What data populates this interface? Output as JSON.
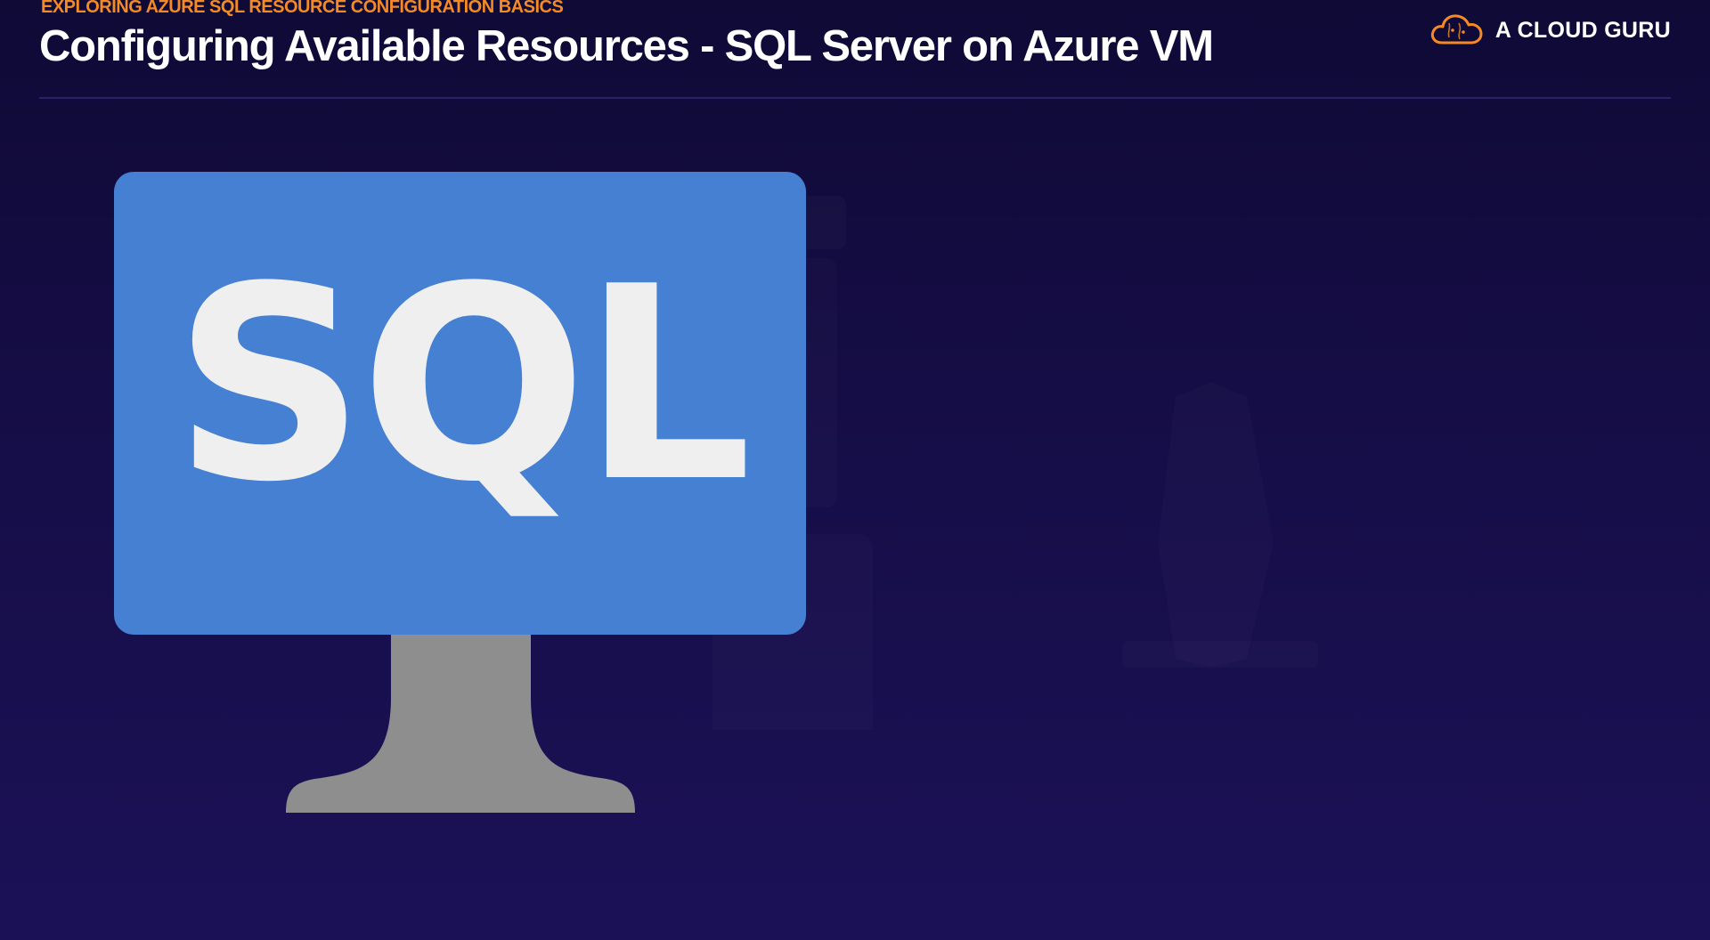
{
  "header": {
    "eyebrow": "EXPLORING AZURE SQL RESOURCE CONFIGURATION BASICS",
    "title": "Configuring Available Resources - SQL Server on Azure VM"
  },
  "logo": {
    "text": "A CLOUD GURU",
    "icon": "cloud-icon"
  },
  "illustration": {
    "monitor_text": "SQL",
    "icon": "sql-monitor-icon"
  },
  "colors": {
    "accent": "#f58a25",
    "background_top": "#0f0a36",
    "background_bottom": "#1b1157",
    "screen": "#4680d2",
    "stand": "#8e8e8e",
    "monitor_text": "#efefef"
  }
}
